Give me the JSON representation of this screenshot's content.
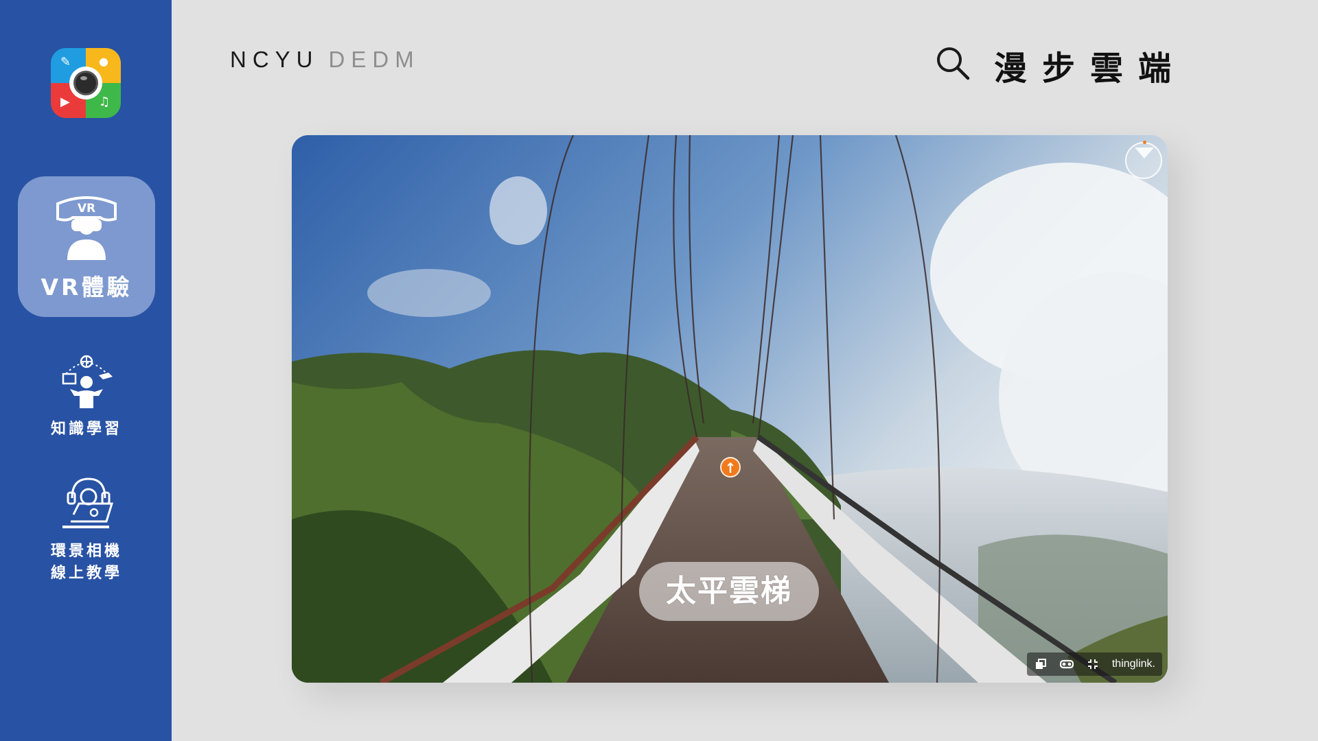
{
  "sidebar": {
    "logo_icons": {
      "pencil": "✎",
      "chat": "●",
      "play": "▶",
      "music": "♫"
    },
    "items": [
      {
        "label": "VR體驗",
        "icon": "vr-headset-icon",
        "active": true
      },
      {
        "label": "知識學習",
        "icon": "learner-juggling-icon",
        "active": false
      },
      {
        "label_line1": "環景相機",
        "label_line2": "線上教學",
        "icon": "headset-laptop-icon",
        "active": false
      }
    ],
    "colors": {
      "background": "#2852a4",
      "active_bg": "#7d99cf"
    }
  },
  "header": {
    "brand_primary": "NCYU",
    "brand_secondary": "DEDM",
    "site_title": "漫步雲端",
    "search_icon": "search-icon"
  },
  "viewer": {
    "place_label": "太平雲梯",
    "hotspot_glyph": "↑",
    "toolbar": {
      "icons": [
        "gallery-icon",
        "vr-goggles-icon",
        "fullscreen-icon"
      ],
      "brand": "thinglink."
    },
    "colors": {
      "hotspot": "#f07a1c"
    }
  }
}
